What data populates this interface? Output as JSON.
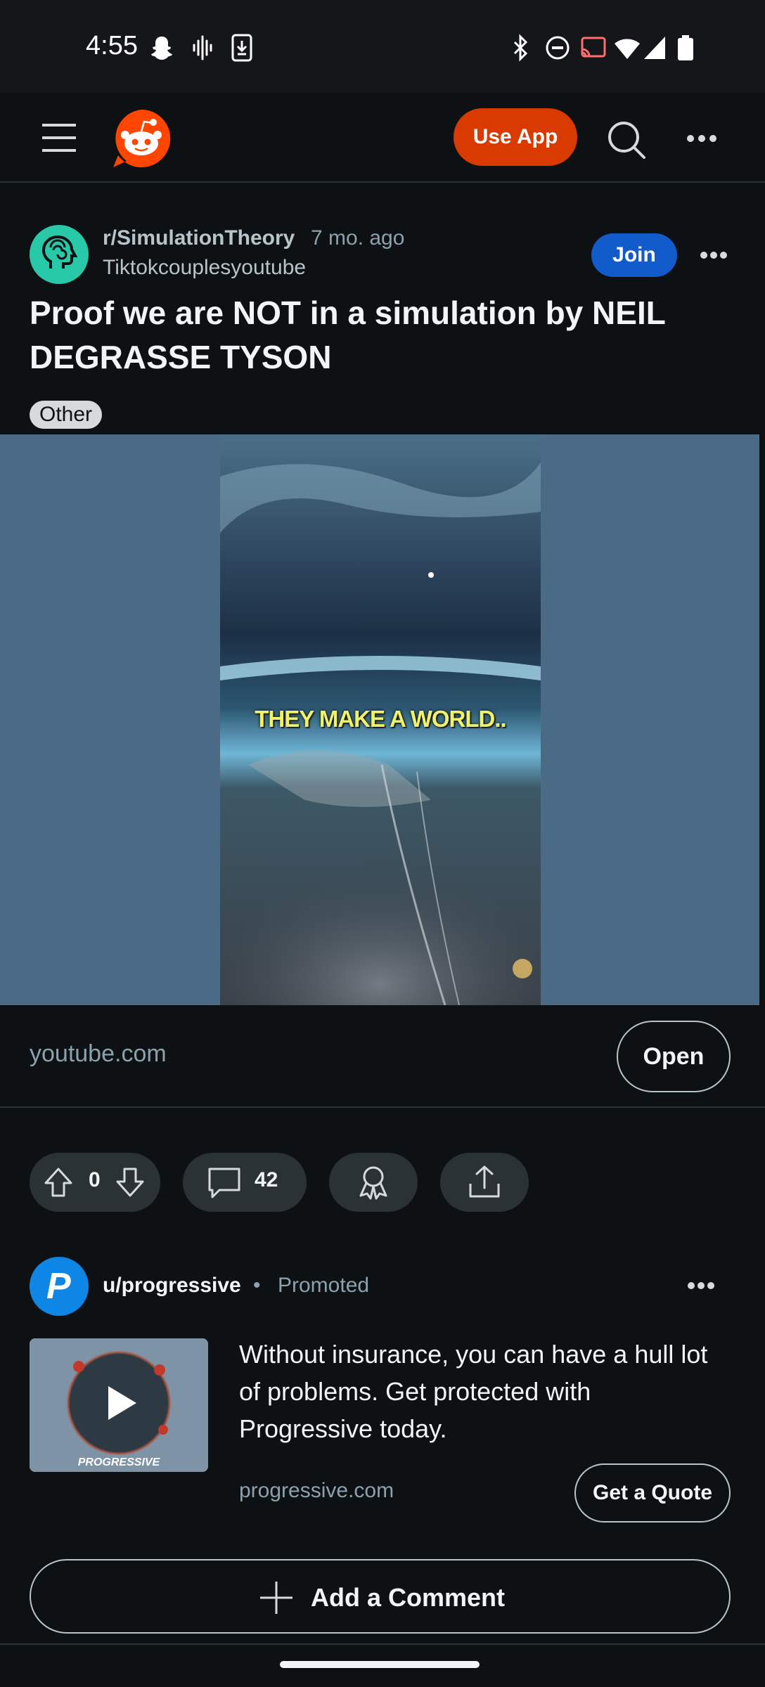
{
  "status_bar": {
    "time": "4:55",
    "left_icons": [
      "snapchat-icon",
      "voicemail-icon",
      "download-icon"
    ],
    "right_icons": [
      "bluetooth-icon",
      "do-not-disturb-icon",
      "cast-icon",
      "wifi-icon",
      "signal-icon",
      "battery-icon"
    ]
  },
  "header": {
    "use_app_label": "Use App",
    "colors": {
      "brand": "#ff4500",
      "use_app": "#d93a00"
    }
  },
  "post": {
    "subreddit": "r/SimulationTheory",
    "age": "7 mo. ago",
    "author": "Tiktokcouplesyoutube",
    "join_label": "Join",
    "title": "Proof we are NOT in a simulation by NEIL DEGRASSE TYSON",
    "flair": "Other",
    "media_caption": "THEY MAKE A WORLD..",
    "link_domain": "youtube.com",
    "open_label": "Open",
    "vote_count": "0",
    "comment_count": "42"
  },
  "promoted": {
    "user": "u/progressive",
    "separator": "•",
    "label": "Promoted",
    "text": "Without insurance, you can have a hull lot of problems. Get protected with Progressive today.",
    "domain": "progressive.com",
    "cta_label": "Get a Quote",
    "thumb_brand": "PROGRESSIVE",
    "avatar_letter": "P"
  },
  "comment_box": {
    "label": "Add a Comment"
  }
}
